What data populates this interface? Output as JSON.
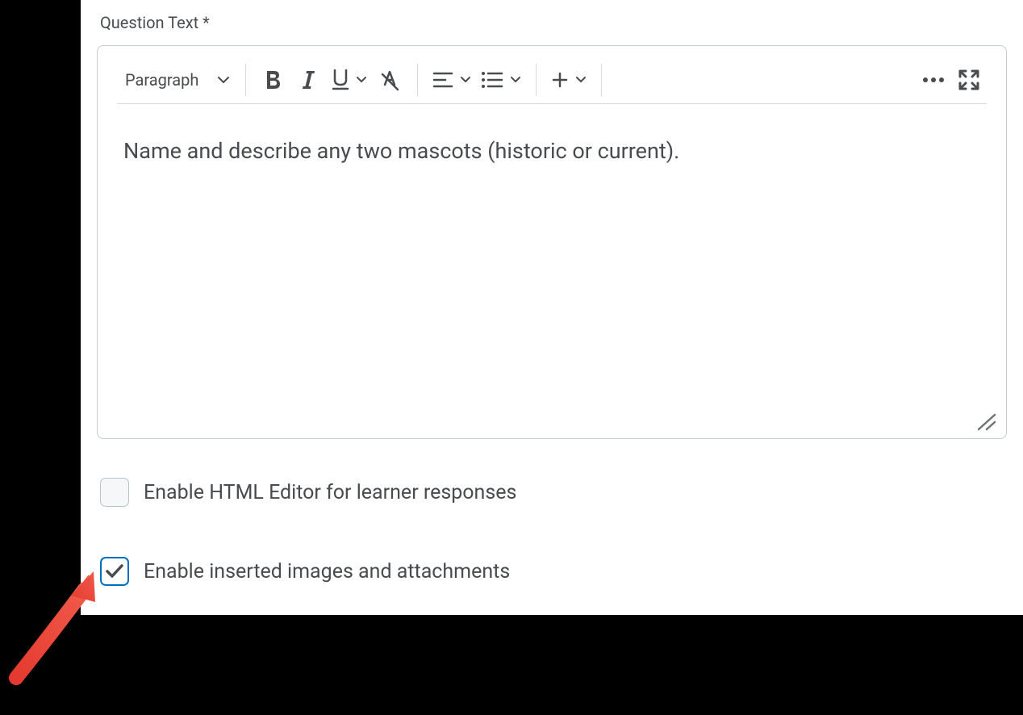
{
  "label": "Question Text *",
  "toolbar": {
    "format_selector": "Paragraph"
  },
  "editor": {
    "content": "Name and describe any two mascots (historic or current)."
  },
  "checkboxes": {
    "html_editor": {
      "label": "Enable HTML Editor for learner responses",
      "checked": false
    },
    "images_attachments": {
      "label": "Enable inserted images and attachments",
      "checked": true
    }
  }
}
